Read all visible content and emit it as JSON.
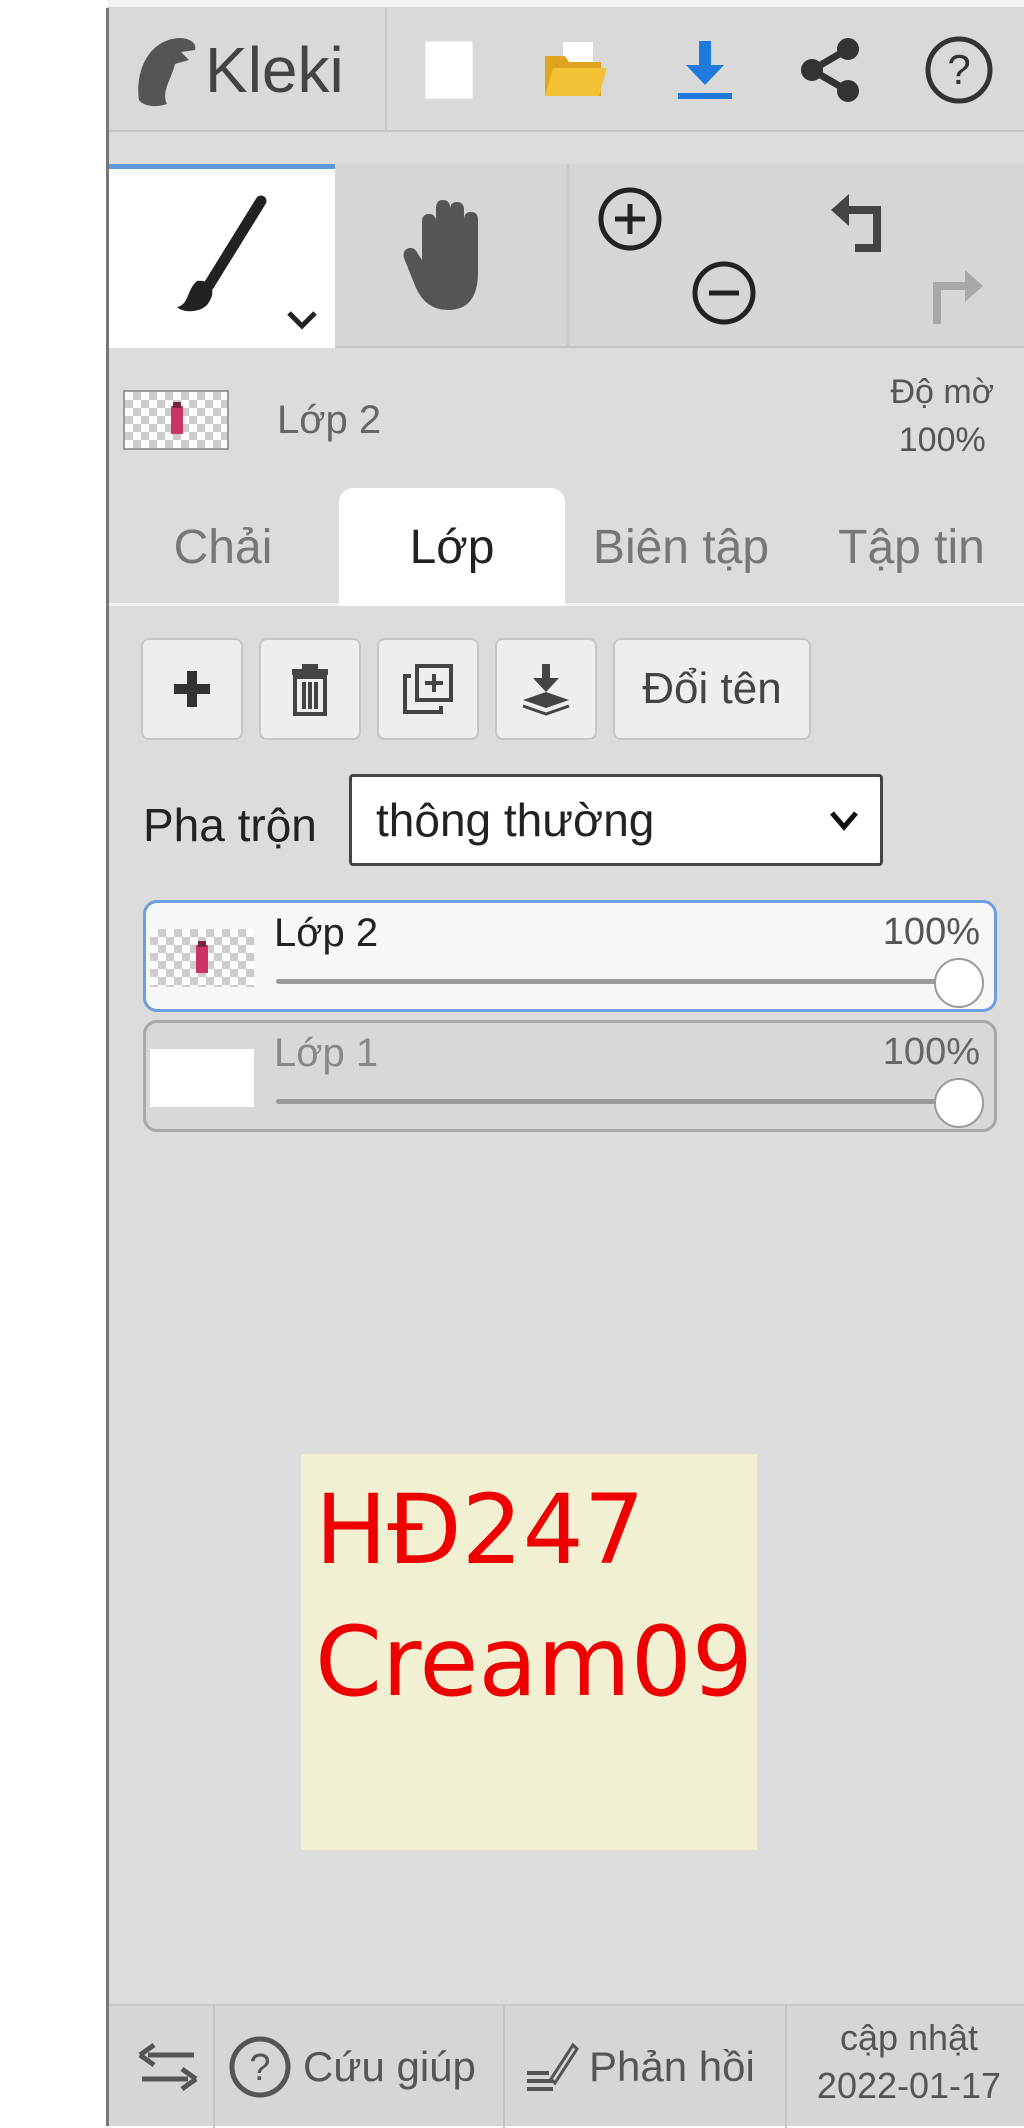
{
  "app": {
    "logo_text": "Kleki"
  },
  "toolbar": {
    "icons": [
      "new-image-icon",
      "open-folder-icon",
      "download-icon",
      "share-icon",
      "help-icon"
    ]
  },
  "tools": {
    "active": "brush",
    "icons": [
      "brush-icon",
      "hand-icon",
      "zoom-in-icon",
      "zoom-out-icon",
      "undo-icon",
      "redo-icon"
    ]
  },
  "layer_info": {
    "name": "Lớp 2",
    "opacity_label": "Độ mờ",
    "opacity_value": "100%"
  },
  "tabs": [
    {
      "label": "Chải",
      "active": false
    },
    {
      "label": "Lớp",
      "active": true
    },
    {
      "label": "Biên tập",
      "active": false
    },
    {
      "label": "Tập tin",
      "active": false
    }
  ],
  "layer_buttons": {
    "rename_label": "Đổi tên"
  },
  "blend": {
    "label": "Pha trộn",
    "value": "thông thường"
  },
  "layers": [
    {
      "name": "Lớp 2",
      "opacity": "100%",
      "selected": true
    },
    {
      "name": "Lớp 1",
      "opacity": "100%",
      "selected": false
    }
  ],
  "note": {
    "line1": "HĐ247",
    "line2": "Cream09"
  },
  "bottom": {
    "help_label": "Cứu giúp",
    "feedback_label": "Phản hồi",
    "update_label": "cập nhật",
    "update_date": "2022-01-17"
  },
  "colors": {
    "accent": "#5b9ae0",
    "note_bg": "#f2f0d3",
    "note_text": "#ee0000",
    "panel_bg": "#dcdcdc"
  }
}
